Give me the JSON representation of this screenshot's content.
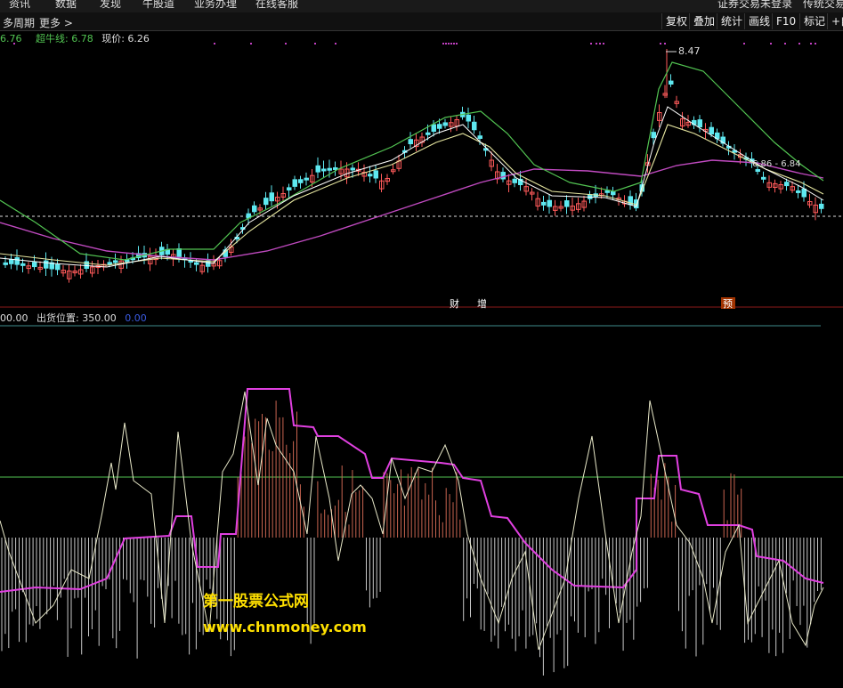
{
  "topbar": {
    "tabs": [
      "资讯",
      "数据",
      "发现",
      "牛股道",
      "业务办理",
      "在线客服"
    ],
    "right": [
      "证券交易未登录",
      "传统交易"
    ]
  },
  "toolbar": {
    "period": "多周期",
    "more": "更多 >",
    "buttons": [
      "复权",
      "叠加",
      "统计",
      "画线",
      "F10",
      "标记",
      "+自"
    ]
  },
  "main_panel": {
    "val_left": "6.76",
    "super_bull_label": "超牛线: 6.78",
    "price_label": "现价: 6.26",
    "high_marker": "8.47",
    "range_marker": "6.86 - 6.84",
    "events": [
      "财",
      "增",
      "预"
    ]
  },
  "sub_panel": {
    "val_left": "00.00",
    "ship_label": "出货位置: 350.00",
    "zero_label": "0.00"
  },
  "watermark": {
    "line1": "第一股票公式网",
    "line2": "www.chnmoney.com"
  },
  "colors": {
    "up": "#ff5a5a",
    "down": "#5ee8f0",
    "ma_fast": "#ffffff",
    "ma_mid": "#e6e6a0",
    "ma_green": "#52c452",
    "ma_purple": "#c04ac0",
    "magenta": "#e040e0"
  }
}
